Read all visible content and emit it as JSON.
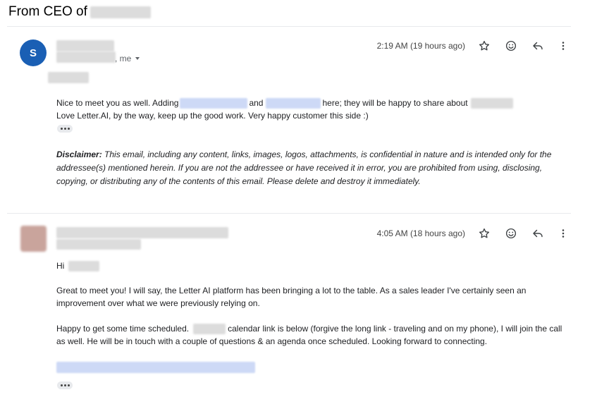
{
  "page": {
    "heading": "From CEO of"
  },
  "message1": {
    "avatar_letter": "S",
    "recipients_label": ", me",
    "time": "2:19 AM (19 hours ago)",
    "body": {
      "l1_a": "Nice to meet you as well. Adding",
      "l1_b": "and",
      "l1_c": "here; they will be happy to share about",
      "l2": "Love Letter.AI, by the way, keep up the good work. Very happy customer this side :)"
    },
    "disclaimer_label": "Disclaimer:",
    "disclaimer_text": " This email, including any content, links, images, logos, attachments, is confidential in nature and is intended only for the addressee(s) mentioned herein. If you are not the addressee or have received it in error, you are prohibited from using, disclosing, copying, or distributing any of the contents of this email. Please delete and destroy it immediately."
  },
  "message2": {
    "time": "4:05 AM (18 hours ago)",
    "greeting": "Hi",
    "p1_l1": "Great to meet you! I will say, the Letter AI platform has been bringing a lot to the table. As a sales leader I've certainly seen an",
    "p1_l2": "improvement over what we were previously relying on.",
    "p2_l1_a": "Happy to get some time scheduled.",
    "p2_l1_b": "calendar link is below (forgive the long link - traveling and on my phone), I will join the call",
    "p2_l2": "as well. He will be in touch with a couple of questions & an agenda once scheduled. Looking forward to connecting."
  },
  "icons": {
    "star": "star-icon",
    "emoji": "emoji-icon",
    "reply": "reply-icon",
    "more": "more-vert-icon",
    "expand": "more-horiz-icon"
  },
  "colors": {
    "avatar_blue": "#1a5fb4",
    "redaction_gray": "#dcdcdc",
    "redaction_blue": "#cdd9f6"
  }
}
